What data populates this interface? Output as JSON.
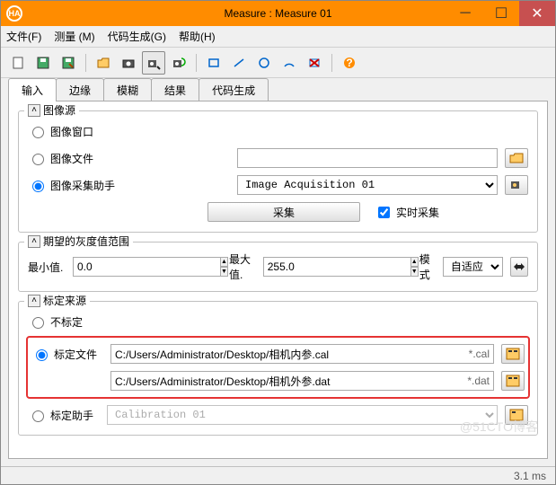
{
  "title": "Measure : Measure 01",
  "menubar": {
    "file": "文件(F)",
    "measure": "测量 (M)",
    "codegen": "代码生成(G)",
    "help": "帮助(H)"
  },
  "tabs": [
    "输入",
    "边缘",
    "模糊",
    "结果",
    "代码生成"
  ],
  "groups": {
    "image_source": {
      "legend": "图像源",
      "opt_window": "图像窗口",
      "opt_file": "图像文件",
      "opt_assistant": "图像采集助手",
      "assistant_value": "Image Acquisition 01",
      "acquire_btn": "采集",
      "realtime_chk": "实时采集"
    },
    "gray_range": {
      "legend": "期望的灰度值范围",
      "min_label": "最小值.",
      "min_value": "0.0",
      "max_label": "最大值.",
      "max_value": "255.0",
      "mode_label": "模式",
      "mode_value": "自适应"
    },
    "calib_source": {
      "legend": "标定来源",
      "opt_none": "不标定",
      "opt_file": "标定文件",
      "path1": "C:/Users/Administrator/Desktop/相机内参.cal",
      "ext1": "*.cal",
      "path2": "C:/Users/Administrator/Desktop/相机外参.dat",
      "ext2": "*.dat",
      "opt_assistant": "标定助手",
      "assistant_value": "Calibration 01"
    }
  },
  "status": "3.1 ms",
  "watermark": "@51CTO博客"
}
